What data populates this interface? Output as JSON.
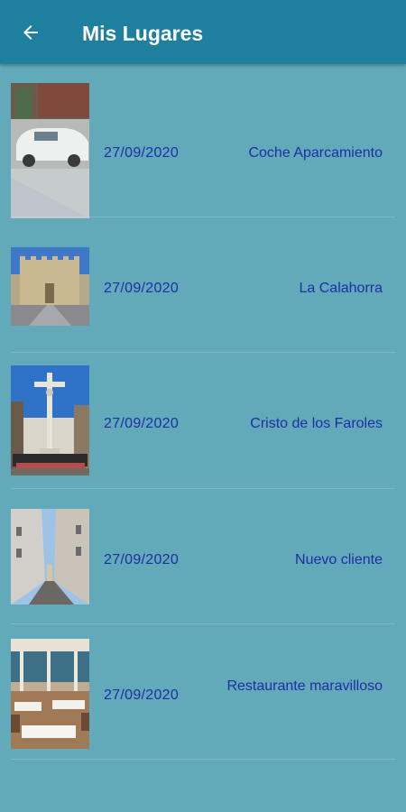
{
  "header": {
    "title": "Mis Lugares",
    "back_icon": "arrow-back-icon",
    "background": "#1e7f9e"
  },
  "colors": {
    "background": "#62a9b9",
    "text": "#1c2fa8"
  },
  "places": [
    {
      "date": "27/09/2020",
      "name": "Coche Aparcamiento",
      "photo": "car-photo"
    },
    {
      "date": "27/09/2020",
      "name": "La Calahorra",
      "photo": "tower-photo"
    },
    {
      "date": "27/09/2020",
      "name": "Cristo de los Faroles",
      "photo": "crucifix-photo"
    },
    {
      "date": "27/09/2020",
      "name": "Nuevo cliente",
      "photo": "street-photo"
    },
    {
      "date": "27/09/2020",
      "name": "Restaurante maravilloso",
      "photo": "restaurant-photo"
    }
  ]
}
